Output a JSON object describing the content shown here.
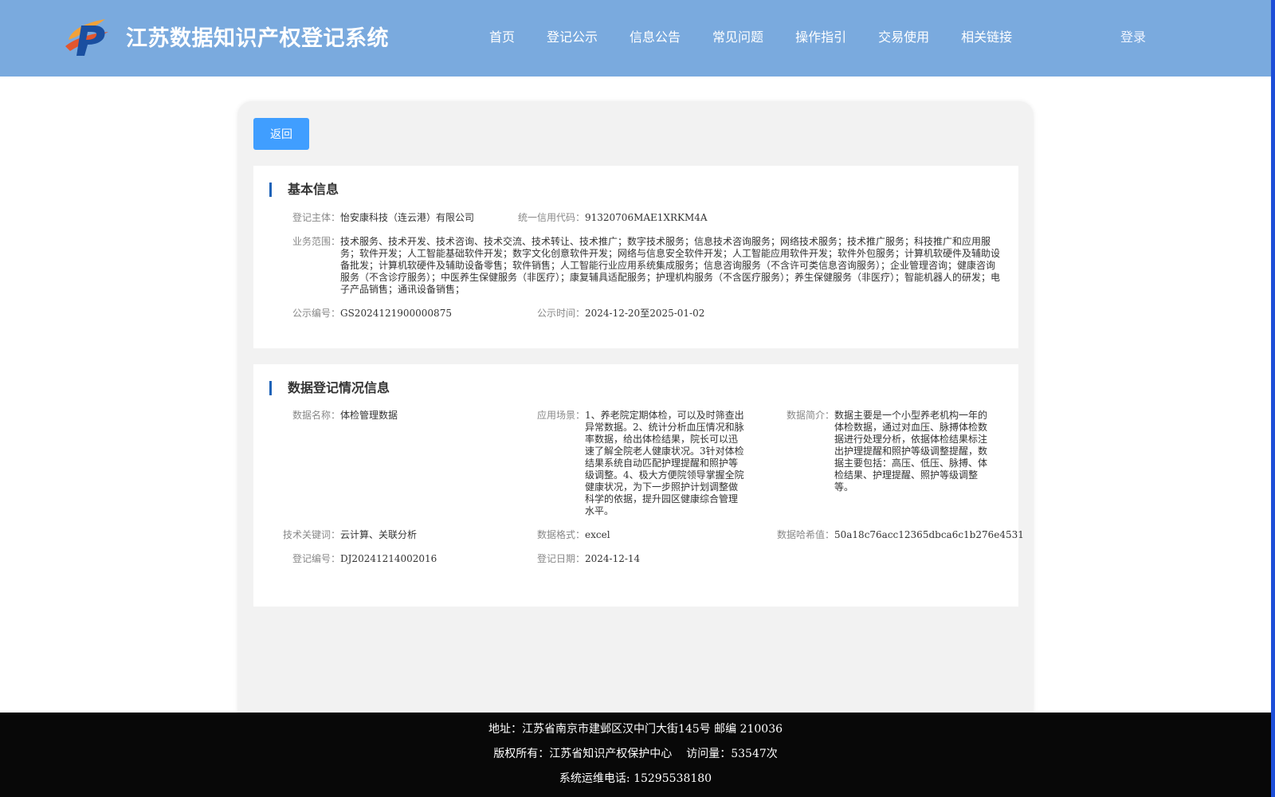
{
  "header": {
    "site_title": "江苏数据知识产权登记系统",
    "nav": [
      "首页",
      "登记公示",
      "信息公告",
      "常见问题",
      "操作指引",
      "交易使用",
      "相关链接"
    ],
    "login": "登录",
    "colors": {
      "header_bg": "#7aaade",
      "accent": "#409eff",
      "title_bar": "#1e63b8"
    }
  },
  "toolbar": {
    "back_label": "返回"
  },
  "basic": {
    "title": "基本信息",
    "subject_label": "登记主体：",
    "subject": "怡安康科技（连云港）有限公司",
    "credit_label": "统一信用代码：",
    "credit": "91320706MAE1XRKM4A",
    "scope_label": "业务范围：",
    "scope": "技术服务、技术开发、技术咨询、技术交流、技术转让、技术推广；数字技术服务；信息技术咨询服务；网络技术服务；技术推广服务；科技推广和应用服务；软件开发；人工智能基础软件开发；数字文化创意软件开发；网络与信息安全软件开发；人工智能应用软件开发；软件外包服务；计算机软硬件及辅助设备批发；计算机软硬件及辅助设备零售；软件销售；人工智能行业应用系统集成服务；信息咨询服务（不含许可类信息咨询服务）；企业管理咨询；健康咨询服务（不含诊疗服务）；中医养生保健服务（非医疗）；康复辅具适配服务；护理机构服务（不含医疗服务）；养生保健服务（非医疗）；智能机器人的研发；电子产品销售；通讯设备销售；",
    "pub_no_label": "公示编号：",
    "pub_no": "GS2024121900000875",
    "pub_time_label": "公示时间：",
    "pub_time": "2024-12-20至2025-01-02"
  },
  "data": {
    "title": "数据登记情况信息",
    "name_label": "数据名称：",
    "name": "体检管理数据",
    "scene_label": "应用场景：",
    "scene": "1、养老院定期体检，可以及时筛查出异常数据。2、统计分析血压情况和脉率数据，给出体检结果，院长可以迅速了解全院老人健康状况。3针对体检结果系统自动匹配护理提醒和照护等级调整。4、极大方便院领导掌握全院健康状况，为下一步照护计划调整做科学的依据，提升园区健康综合管理水平。",
    "intro_label": "数据简介：",
    "intro": "数据主要是一个小型养老机构一年的体检数据，通过对血压、脉搏体检数据进行处理分析，依据体检结果标注出护理提醒和照护等级调整提醒，数据主要包括：高压、低压、脉搏、体检结果、护理提醒、照护等级调整等。",
    "keywords_label": "技术关键词：",
    "keywords": "云计算、关联分析",
    "format_label": "数据格式：",
    "format": "excel",
    "hash_label": "数据哈希值：",
    "hash": "50a18c76acc12365dbca6c1b276e4531",
    "reg_no_label": "登记编号：",
    "reg_no": "DJ20241214002016",
    "reg_date_label": "登记日期：",
    "reg_date": "2024-12-14"
  },
  "footer": {
    "address": "地址：江苏省南京市建邺区汉中门大街145号 邮编 210036",
    "copyright": "版权所有：江苏省知识产权保护中心",
    "visits": "访问量：53547次",
    "phone": "系统运维电话: 15295538180"
  }
}
